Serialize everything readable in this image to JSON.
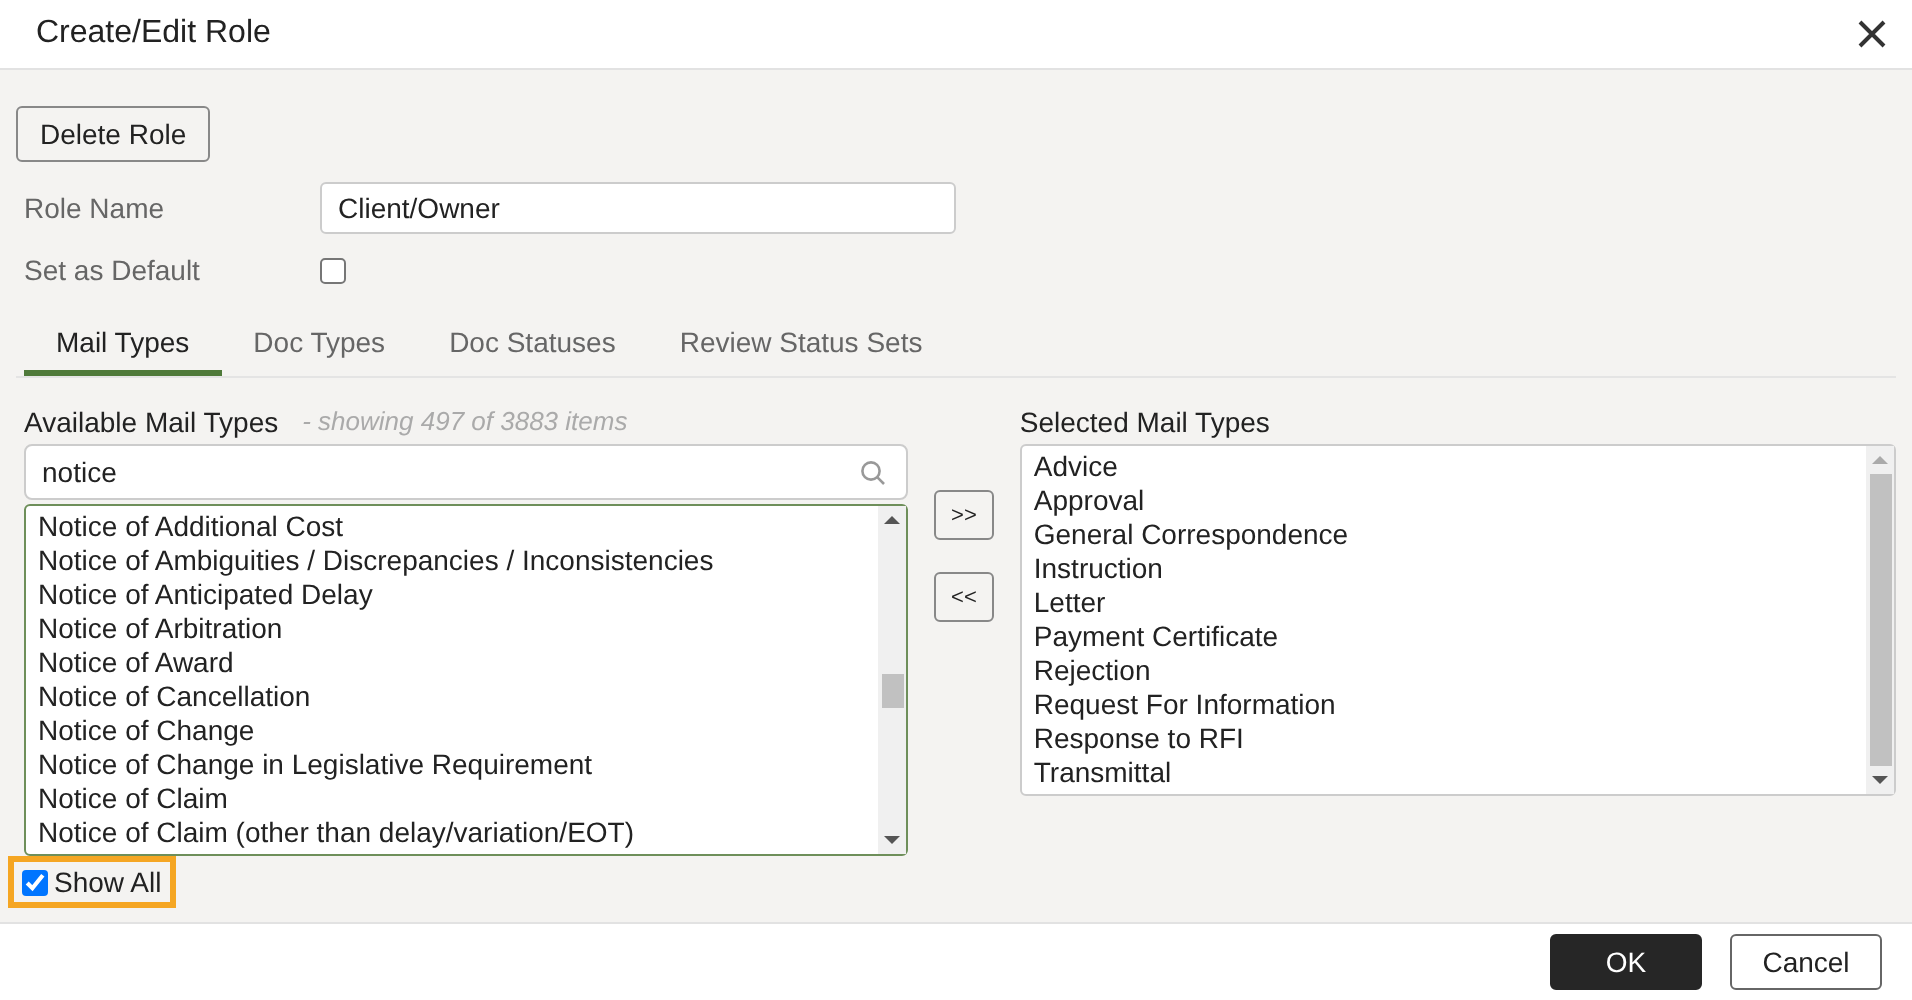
{
  "window": {
    "title": "Create/Edit Role"
  },
  "delete_button": "Delete Role",
  "role_name": {
    "label": "Role Name",
    "value": "Client/Owner"
  },
  "set_as_default": {
    "label": "Set as Default",
    "checked": false
  },
  "tabs": [
    {
      "label": "Mail Types",
      "selected": true
    },
    {
      "label": "Doc Types",
      "selected": false
    },
    {
      "label": "Doc Statuses",
      "selected": false
    },
    {
      "label": "Review Status Sets",
      "selected": false
    }
  ],
  "available": {
    "title": "Available Mail Types",
    "count_note": "- showing 497 of 3883 items",
    "search": "notice",
    "items": [
      "Notice of Additional Cost",
      "Notice of Ambiguities / Discrepancies / Inconsistencies",
      "Notice of Anticipated Delay",
      "Notice of Arbitration",
      "Notice of Award",
      "Notice of Cancellation",
      "Notice of Change",
      "Notice of Change in Legislative Requirement",
      "Notice of Claim",
      "Notice of Claim (other than delay/variation/EOT)"
    ]
  },
  "move_buttons": [
    ">>",
    "<<"
  ],
  "selected_list": {
    "title": "Selected Mail Types",
    "items": [
      "Advice",
      "Approval",
      "General Correspondence",
      "Instruction",
      "Letter",
      "Payment Certificate",
      "Rejection",
      "Request For Information",
      "Response to RFI",
      "Transmittal"
    ]
  },
  "show_all": {
    "label": "Show All",
    "checked": true,
    "highlighted": true
  },
  "footer_buttons": [
    {
      "label": "OK",
      "kind": "primary"
    },
    {
      "label": "Cancel",
      "kind": "secondary"
    }
  ]
}
